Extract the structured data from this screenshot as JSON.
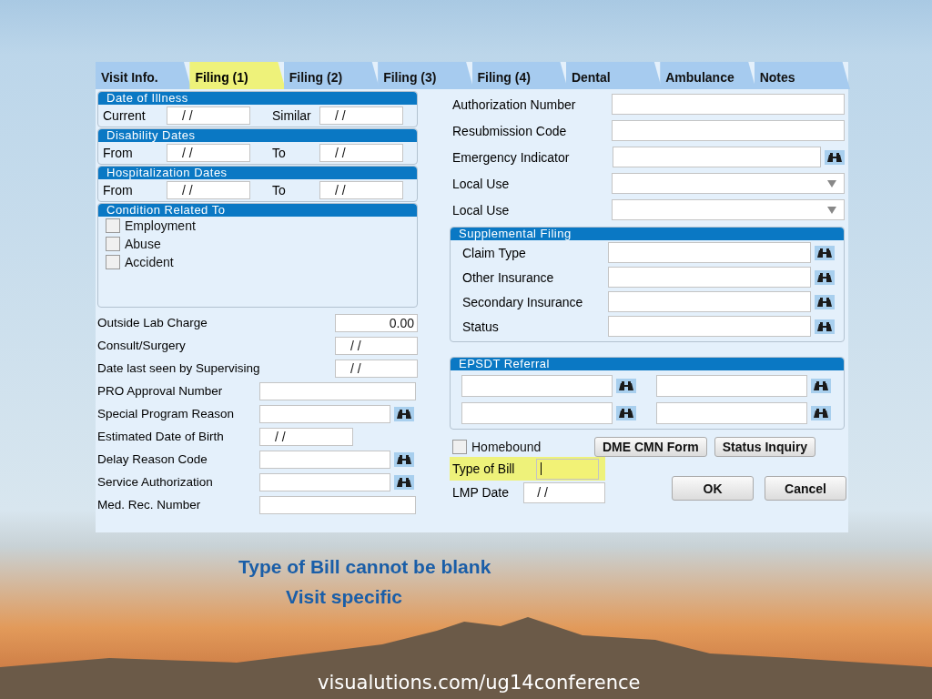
{
  "tabs": [
    {
      "label": "Visit Info.",
      "selected": false
    },
    {
      "label": "Filing (1)",
      "selected": true
    },
    {
      "label": "Filing (2)",
      "selected": false
    },
    {
      "label": "Filing (3)",
      "selected": false
    },
    {
      "label": "Filing (4)",
      "selected": false
    },
    {
      "label": "Dental",
      "selected": false
    },
    {
      "label": "Ambulance",
      "selected": false
    },
    {
      "label": "Notes",
      "selected": false
    }
  ],
  "date_groups": [
    {
      "title": "Date of Illness",
      "fields": [
        {
          "label": "Current",
          "value": "/ /"
        },
        {
          "label": "Similar",
          "value": "/ /"
        }
      ]
    },
    {
      "title": "Disability Dates",
      "fields": [
        {
          "label": "From",
          "value": "/ /"
        },
        {
          "label": "To",
          "value": "/ /"
        }
      ]
    },
    {
      "title": "Hospitalization Dates",
      "fields": [
        {
          "label": "From",
          "value": "/ /"
        },
        {
          "label": "To",
          "value": "/ /"
        }
      ]
    }
  ],
  "condition": {
    "title": "Condition Related To",
    "items": [
      {
        "label": "Employment",
        "checked": false
      },
      {
        "label": "Abuse",
        "checked": false
      },
      {
        "label": "Accident",
        "checked": false
      }
    ]
  },
  "left_fields": [
    {
      "label": "Outside Lab Charge",
      "value": "0.00",
      "kind": "amount"
    },
    {
      "label": "Consult/Surgery",
      "value": "/ /",
      "kind": "date"
    },
    {
      "label": "Date last seen by Supervising",
      "value": "/ /",
      "kind": "date"
    },
    {
      "label": "PRO Approval Number",
      "kind": "text"
    },
    {
      "label": "Special Program Reason",
      "kind": "lookup"
    },
    {
      "label": "Estimated Date of Birth",
      "value": "/ /",
      "kind": "short"
    },
    {
      "label": "Delay Reason Code",
      "kind": "lookup"
    },
    {
      "label": "Service Authorization",
      "kind": "lookup"
    },
    {
      "label": "Med. Rec. Number",
      "kind": "text"
    }
  ],
  "right_fields": [
    {
      "label": "Authorization Number",
      "kind": "text"
    },
    {
      "label": "Resubmission Code",
      "kind": "text"
    },
    {
      "label": "Emergency Indicator",
      "kind": "lookup"
    },
    {
      "label": "Local Use",
      "kind": "dropdown"
    },
    {
      "label": "Local Use",
      "kind": "dropdown"
    }
  ],
  "supplemental": {
    "title": "Supplemental Filing",
    "fields": [
      {
        "label": "Claim Type"
      },
      {
        "label": "Other Insurance"
      },
      {
        "label": "Secondary Insurance"
      },
      {
        "label": "Status"
      }
    ]
  },
  "epsdt": {
    "title": "EPSDT Referral"
  },
  "homebound": {
    "label": "Homebound",
    "checked": false
  },
  "action_buttons": [
    "DME CMN Form",
    "Status Inquiry"
  ],
  "bottom_fields": [
    {
      "label": "Type of Bill",
      "highlighted": true,
      "focused": true
    },
    {
      "label": "LMP Date",
      "value": "/ /",
      "highlighted": false,
      "focused": false
    }
  ],
  "dialog_buttons": [
    "OK",
    "Cancel"
  ],
  "caption": [
    "Type of Bill cannot be blank",
    "Visit specific"
  ],
  "footer": "visualutions.com/ug14conference"
}
